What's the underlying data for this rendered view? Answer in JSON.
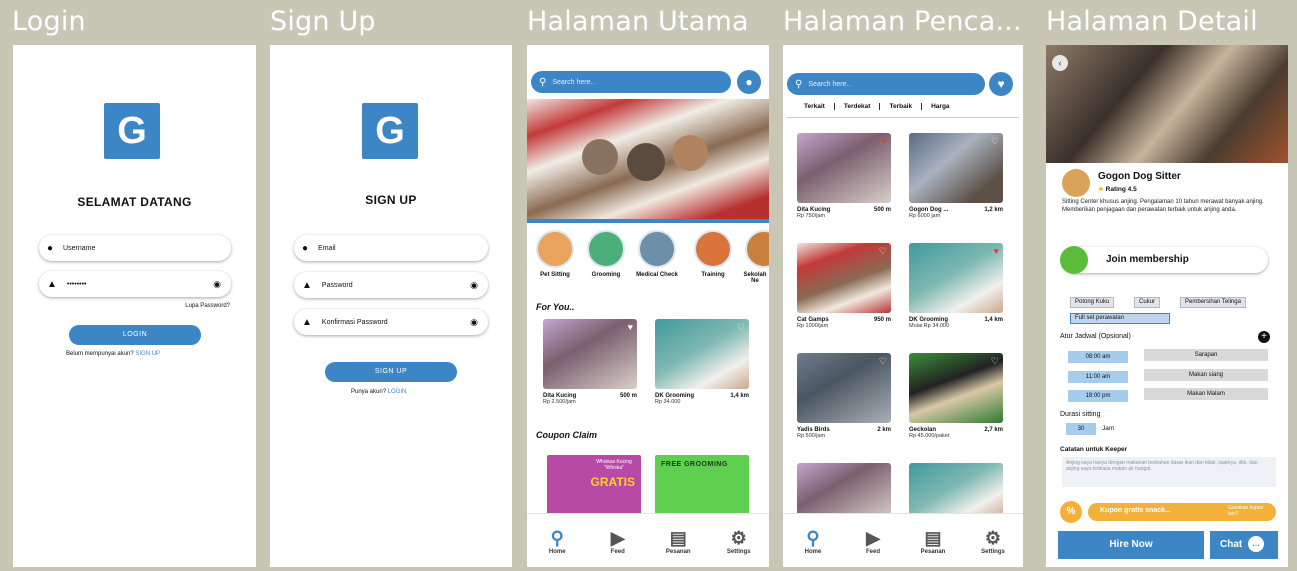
{
  "frames": {
    "login": "Login",
    "signup": "Sign Up",
    "home": "Halaman Utama",
    "search": "Halaman Penca...",
    "detail": "Halaman Detail"
  },
  "login": {
    "logo": "G",
    "heading": "SELAMAT DATANG",
    "username_placeholder": "Username",
    "password_value": "••••••••",
    "forgot": "Lupa Password?",
    "login_button": "LOGIN",
    "no_account": "Belum mempunyai akun?",
    "signup_link": "SIGN UP"
  },
  "signup": {
    "logo": "G",
    "heading": "SIGN UP",
    "email_placeholder": "Email",
    "password_placeholder": "Password",
    "confirm_placeholder": "Konfirmasi Password",
    "signup_button": "SIGN UP",
    "have_account": "Punya akun?",
    "login_link": "LOGIN"
  },
  "home": {
    "search_placeholder": "Search here..",
    "categories": [
      {
        "label": "Pet Sitting",
        "color": "#e8a45a"
      },
      {
        "label": "Grooming",
        "color": "#4caf7a"
      },
      {
        "label": "Medical Check",
        "color": "#6d8fa8"
      },
      {
        "label": "Training",
        "color": "#d9743d"
      },
      {
        "label": "Sekolah Ne",
        "color": "#c9803c"
      }
    ],
    "for_you_title": "For You..",
    "for_you": [
      {
        "name": "Dita Kucing",
        "dist": "500 m",
        "price": "Rp 2.500/jam"
      },
      {
        "name": "DK Grooming",
        "dist": "1,4 km",
        "price": "Rp 34.000"
      }
    ],
    "coupon_title": "Coupon Claim",
    "coupons": [
      {
        "text": "Whiskas Kucing \"Whiska\"",
        "big": "GRATIS"
      },
      {
        "text": "FREE GROOMING",
        "big": ""
      }
    ]
  },
  "search": {
    "search_placeholder": "Search here..",
    "filters": [
      "Terkait",
      "Terdekat",
      "Terbaik",
      "Harga"
    ],
    "results": [
      {
        "name": "Dita Kucing",
        "dist": "500 m",
        "price": "Rp 750/jam"
      },
      {
        "name": "Gogon Dog ...",
        "dist": "1,2 km",
        "price": "Rp 6000 jam"
      },
      {
        "name": "Cat Gamps",
        "dist": "950 m",
        "price": "Rp 1000/jam"
      },
      {
        "name": "DK Grooming",
        "dist": "1,4 km",
        "price": "Mulai Rp 34.000"
      },
      {
        "name": "Yadis Birds",
        "dist": "2 km",
        "price": "Rp 500/jam"
      },
      {
        "name": "Geckolan",
        "dist": "2,7 km",
        "price": "Rp 45.000/paket"
      }
    ]
  },
  "nav": [
    "Home",
    "Feed",
    "Pesanan",
    "Settings"
  ],
  "detail": {
    "name": "Gogon Dog Sitter",
    "rating": "Rating 4.5",
    "description": "Sitting Center khusus anjing. Pengalaman 10 tahun merawat banyak anjing. Memberikan penjagaan dan perawatan terbaik untuk anjing anda.",
    "membership": "Join membership",
    "services": [
      "Potong Kuku",
      "Cukur",
      "Pembersihan Telinga",
      "Full set perawatan"
    ],
    "schedule_label": "Atur Jadwal (Opsional)",
    "schedule": [
      {
        "time": "08:00 am",
        "activity": "Sarapan"
      },
      {
        "time": "11:00 am",
        "activity": "Makan siang"
      },
      {
        "time": "18:00 pm",
        "activity": "Makan Malam"
      }
    ],
    "duration_label": "Durasi sitting",
    "duration_value": "30",
    "duration_unit": "Jam",
    "notes_label": "Catatan untuk Keeper",
    "notes_text": "Anjing saya hanya dengan makanan berbahan dasar ikan dan tidak, saatnya, dkk. dan anjing saya terbiasa makan air hangat.",
    "coupon": "Kupon gratis snack...",
    "coupon_hint": "Gunakan kupon lain?",
    "hire_button": "Hire Now",
    "chat_button": "Chat"
  },
  "colors": {
    "primary": "#3d86c6",
    "bg": "#c8c7b6",
    "coupon": "#f4b13a"
  }
}
